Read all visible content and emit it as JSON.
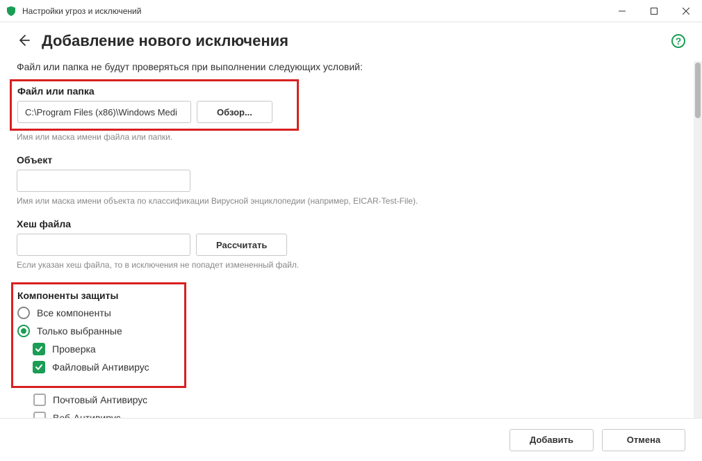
{
  "window": {
    "title": "Настройки угроз и исключений"
  },
  "page": {
    "title": "Добавление нового исключения",
    "intro": "Файл или папка не будут проверяться при выполнении следующих условий:"
  },
  "file_section": {
    "label": "Файл или папка",
    "path_value": "C:\\Program Files (x86)\\Windows Medi",
    "browse_label": "Обзор...",
    "hint": "Имя или маска имени файла или папки."
  },
  "object_section": {
    "label": "Объект",
    "value": "",
    "hint": "Имя или маска имени объекта по классификации Вирусной энциклопедии (например, EICAR-Test-File)."
  },
  "hash_section": {
    "label": "Хеш файла",
    "value": "",
    "calc_label": "Рассчитать",
    "hint": "Если указан хеш файла, то в исключения не попадет измененный файл."
  },
  "components": {
    "label": "Компоненты защиты",
    "radio_all": "Все компоненты",
    "radio_selected": "Только выбранные",
    "items": [
      {
        "label": "Проверка",
        "checked": true
      },
      {
        "label": "Файловый Антивирус",
        "checked": true
      },
      {
        "label": "Почтовый Антивирус",
        "checked": false
      },
      {
        "label": "Веб-Антивирус",
        "checked": false
      }
    ]
  },
  "footer": {
    "add_label": "Добавить",
    "cancel_label": "Отмена"
  }
}
